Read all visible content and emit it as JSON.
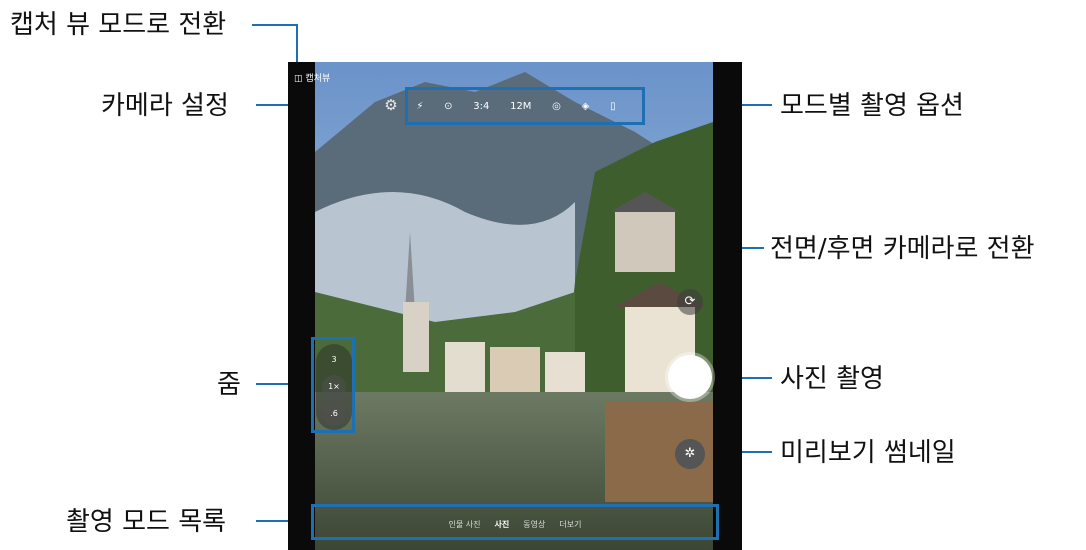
{
  "callouts": {
    "capture_view": "캡처 뷰 모드로 전환",
    "camera_settings": "카메라 설정",
    "zoom": "줌",
    "mode_list": "촬영 모드 목록",
    "mode_options": "모드별 촬영 옵션",
    "switch_camera": "전면/후면 카메라로 전환",
    "take_photo": "사진 촬영",
    "preview_thumbnail": "미리보기 썸네일"
  },
  "screen": {
    "capture_view_label": "캡처뷰",
    "settings_icon": "gear-icon",
    "options": [
      "⚡",
      "⊙",
      "3:4",
      "12M",
      "◎",
      "◈",
      "▯"
    ],
    "zoom": {
      "top": "3",
      "mid": "1×",
      "bottom": ".6"
    },
    "switch_icon": "rotate-camera-icon",
    "thumbnail_icon": "✲",
    "modes": [
      {
        "label": "인물 사진",
        "selected": false
      },
      {
        "label": "사진",
        "selected": true
      },
      {
        "label": "동영상",
        "selected": false
      },
      {
        "label": "더보기",
        "selected": false
      }
    ]
  },
  "colors": {
    "accent": "#1f6fb3"
  }
}
